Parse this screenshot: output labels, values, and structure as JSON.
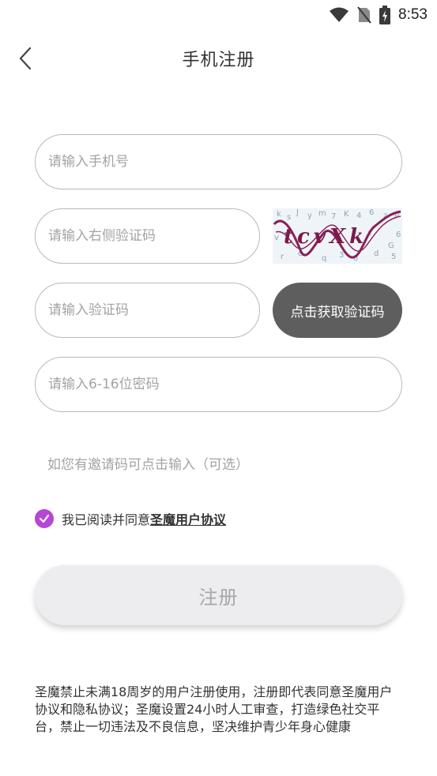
{
  "status_bar": {
    "time": "8:53",
    "icons": [
      "wifi-icon",
      "no-sim-icon",
      "battery-charging-icon"
    ]
  },
  "header": {
    "title": "手机注册",
    "back_icon": "chevron-left-icon"
  },
  "form": {
    "phone_placeholder": "请输入手机号",
    "phone_value": "",
    "captcha_placeholder": "请输入右侧验证码",
    "captcha_value": "",
    "captcha_image_text": "tcvXk",
    "sms_placeholder": "请输入验证码",
    "sms_value": "",
    "get_code_label": "点击获取验证码",
    "password_placeholder": "请输入6-16位密码",
    "password_value": ""
  },
  "invite": {
    "label": "如您有邀请码可点击输入（可选）"
  },
  "agreement": {
    "checked": true,
    "text": "我已阅读并同意",
    "link_label": "圣魔用户协议"
  },
  "submit": {
    "label": "注册"
  },
  "notice": {
    "text": "圣魔禁止未满18周岁的用户注册使用，注册即代表同意圣魔用户协议和隐私协议；圣魔设置24小时人工审查，打造绿色社交平台，禁止一切违法及不良信息，坚决维护青少年身心健康"
  },
  "colors": {
    "accent": "#b646d3",
    "button_dark": "#5e5e5e",
    "placeholder": "#a3a3a3",
    "border": "#b9b9b9"
  }
}
